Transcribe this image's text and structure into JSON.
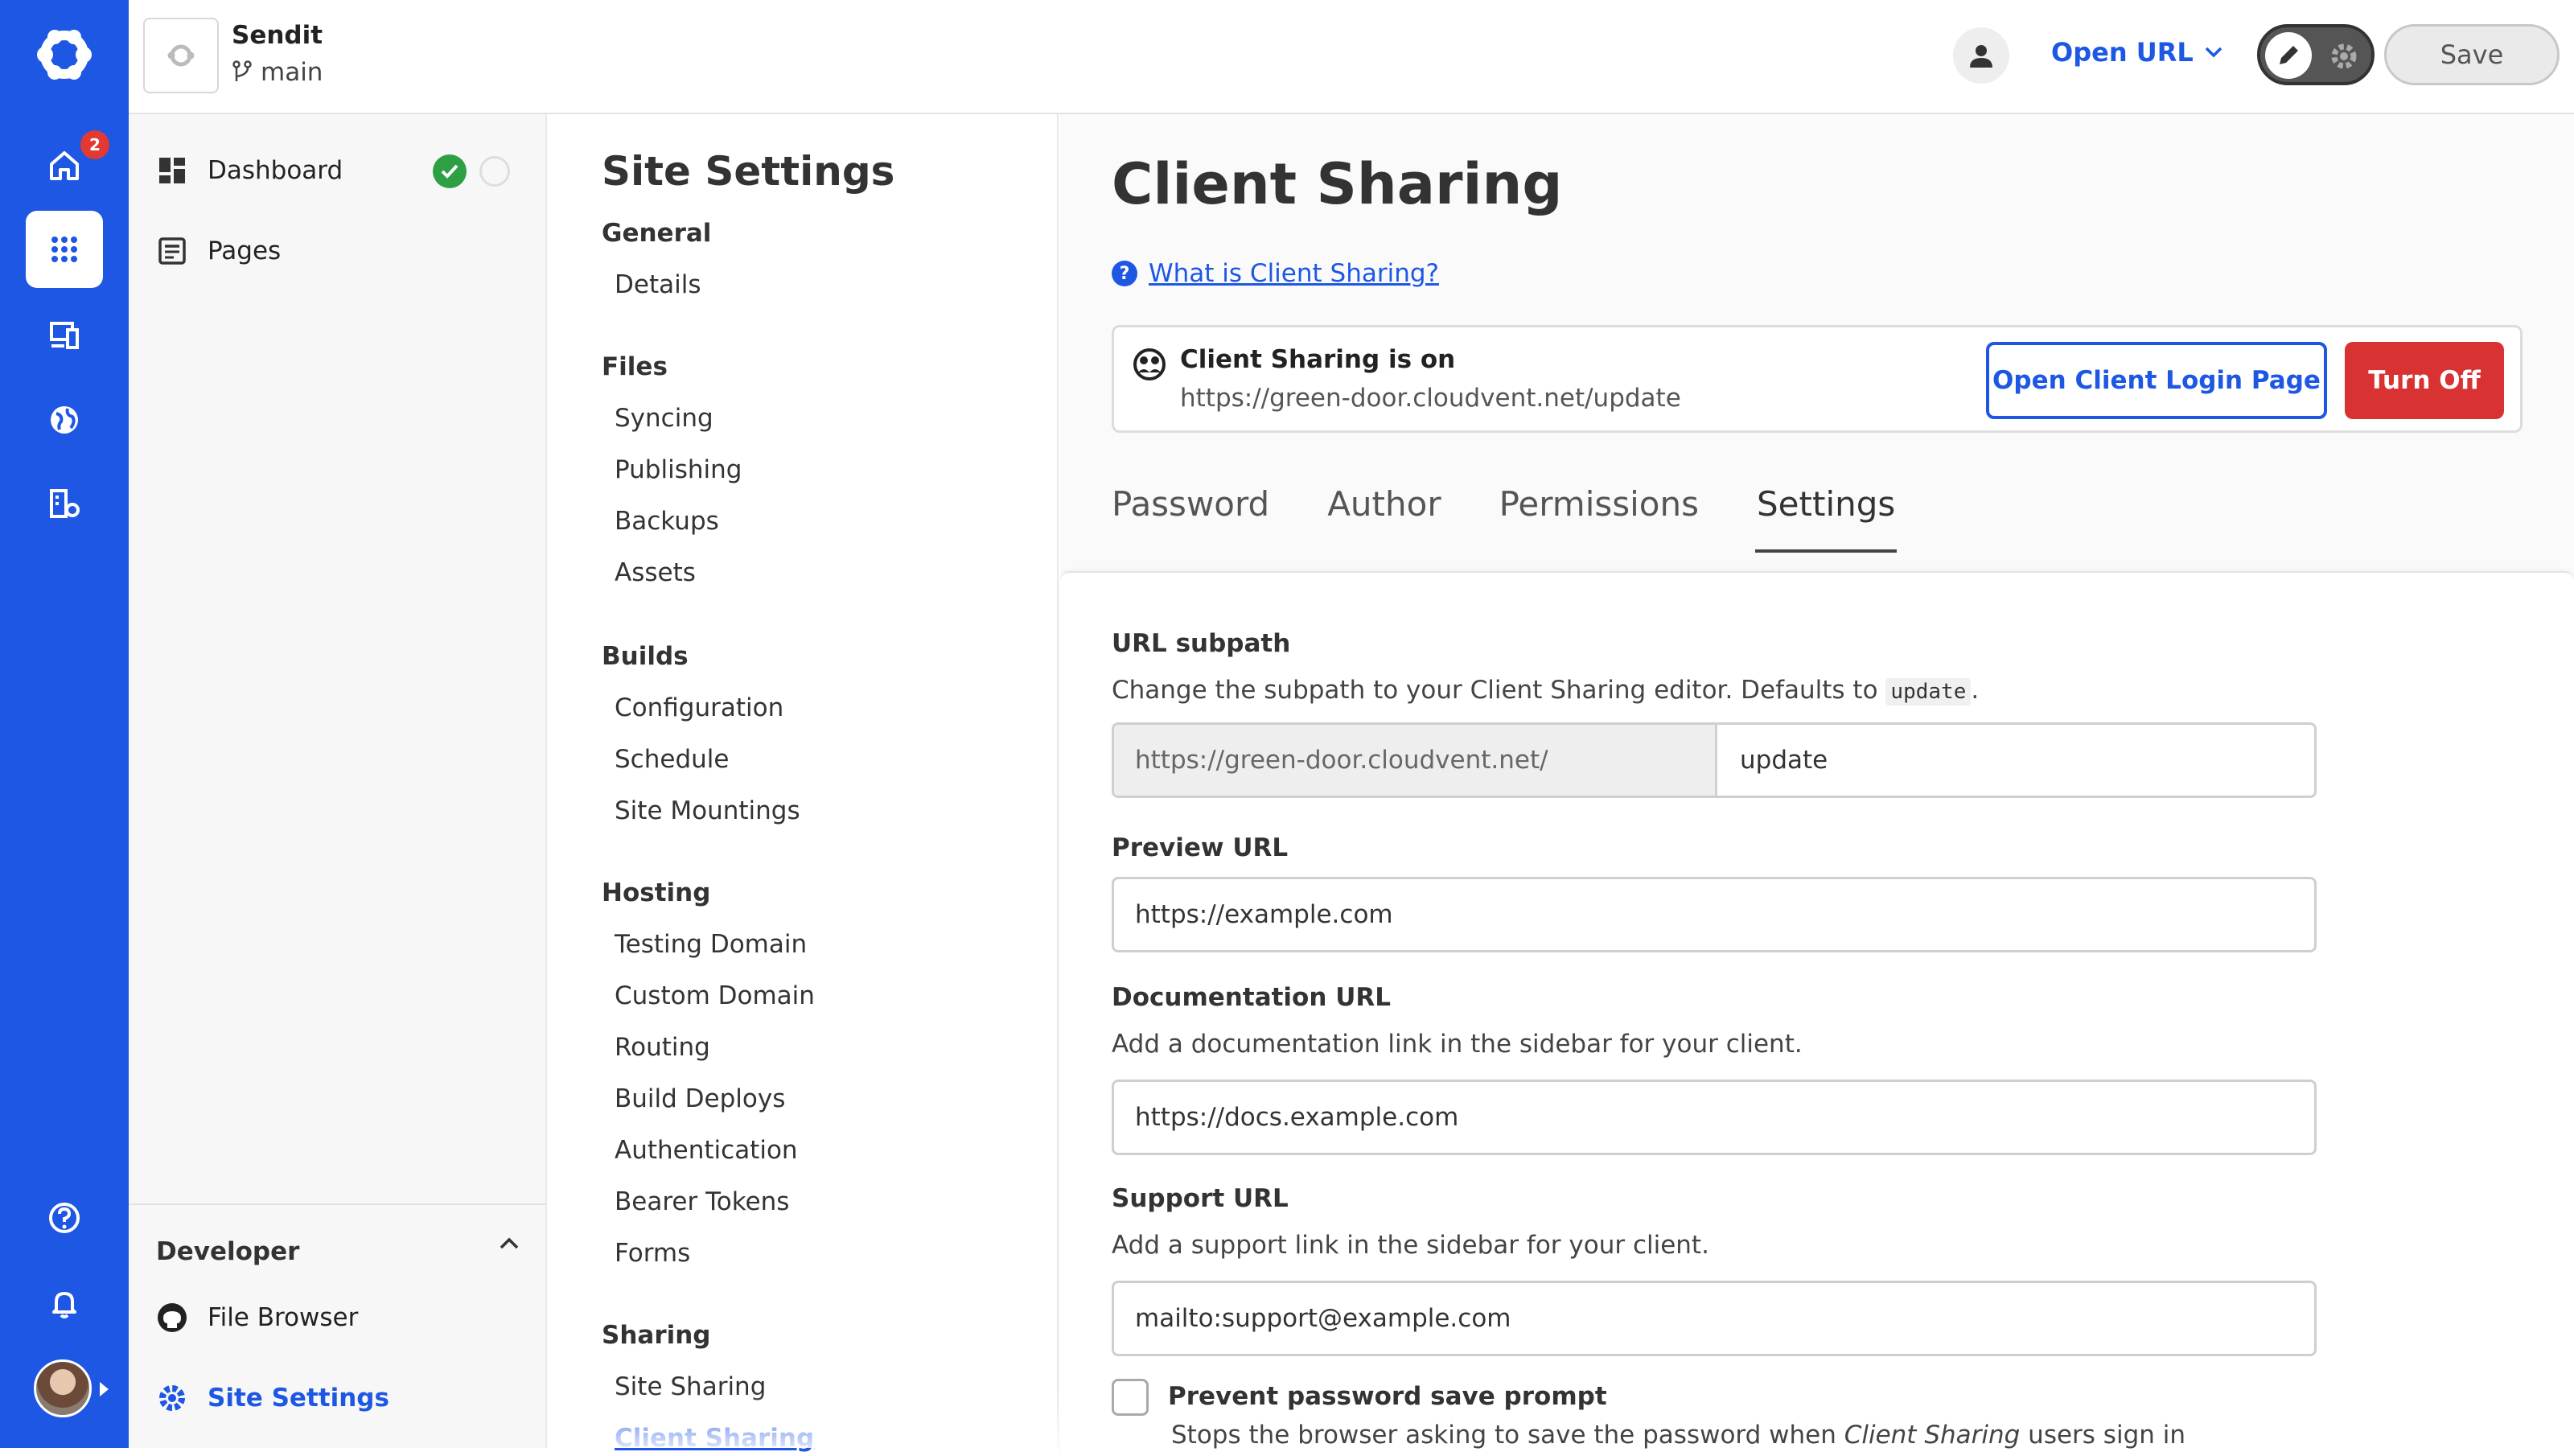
{
  "rail": {
    "badge": "2"
  },
  "topbar": {
    "site_name": "Sendit",
    "branch": "main",
    "open_url": "Open URL",
    "save": "Save"
  },
  "sitenav": {
    "dashboard": "Dashboard",
    "pages": "Pages",
    "developer_heading": "Developer",
    "file_browser": "File Browser",
    "site_settings": "Site Settings"
  },
  "settingsnav": {
    "title": "Site Settings",
    "groups": [
      {
        "label": "General",
        "items": [
          "Details"
        ]
      },
      {
        "label": "Files",
        "items": [
          "Syncing",
          "Publishing",
          "Backups",
          "Assets"
        ]
      },
      {
        "label": "Builds",
        "items": [
          "Configuration",
          "Schedule",
          "Site Mountings"
        ]
      },
      {
        "label": "Hosting",
        "items": [
          "Testing Domain",
          "Custom Domain",
          "Routing",
          "Build Deploys",
          "Authentication",
          "Bearer Tokens",
          "Forms"
        ]
      },
      {
        "label": "Sharing",
        "items": [
          "Site Sharing",
          "Client Sharing"
        ]
      }
    ],
    "active_item": "Client Sharing"
  },
  "main": {
    "title": "Client Sharing",
    "help_link": "What is Client Sharing?",
    "status": {
      "title": "Client Sharing is on",
      "url": "https://green-door.cloudvent.net/update",
      "open_login_label": "Open Client Login Page",
      "turn_off_label": "Turn Off"
    },
    "tabs": [
      "Password",
      "Author",
      "Permissions",
      "Settings"
    ],
    "active_tab": "Settings",
    "fields": {
      "url_subpath": {
        "label": "URL subpath",
        "desc_before": "Change the subpath to your Client Sharing editor. Defaults to ",
        "desc_code": "update",
        "desc_after": ".",
        "prefix": "https://green-door.cloudvent.net/",
        "value": "update"
      },
      "preview_url": {
        "label": "Preview URL",
        "value": "https://example.com"
      },
      "documentation_url": {
        "label": "Documentation URL",
        "desc": "Add a documentation link in the sidebar for your client.",
        "value": "https://docs.example.com"
      },
      "support_url": {
        "label": "Support URL",
        "desc": "Add a support link in the sidebar for your client.",
        "value": "mailto:support@example.com"
      },
      "prevent_prompt": {
        "label": "Prevent password save prompt",
        "desc_before": "Stops the browser asking to save the password when ",
        "desc_em": "Client Sharing",
        "desc_after": " users sign in",
        "checked": false
      }
    }
  },
  "colors": {
    "brand": "#1d57e4",
    "danger": "#d93232",
    "success": "#2ea043"
  }
}
